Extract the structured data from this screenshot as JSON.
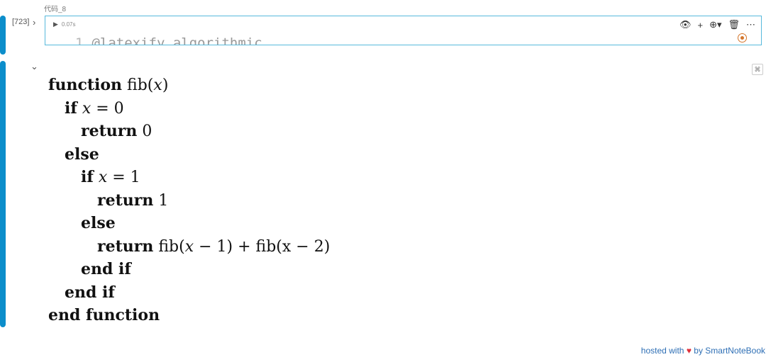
{
  "cell": {
    "name": "代码_8",
    "execution_count": "[723]",
    "collapse_glyph": "›",
    "run_time": "0.07s",
    "line_number": "1",
    "code": "@latexify.algorithmic"
  },
  "toolbar": {
    "eye": "👁",
    "add": "+",
    "puzzle": "⊕▾",
    "delete": "🗑",
    "more": "⋯"
  },
  "output": {
    "collapse_glyph": "⌄",
    "toggle_glyph": "⌘",
    "algorithm": [
      {
        "kw": "function",
        "rest": " fib(",
        "var": "x",
        "tail": ")"
      },
      {
        "kw": "if",
        "rest": " ",
        "var": "x",
        "tail": " = 0"
      },
      {
        "kw": "return",
        "rest": " 0",
        "var": "",
        "tail": ""
      },
      {
        "kw": "else",
        "rest": "",
        "var": "",
        "tail": ""
      },
      {
        "kw": "if",
        "rest": " ",
        "var": "x",
        "tail": " = 1"
      },
      {
        "kw": "return",
        "rest": " 1",
        "var": "",
        "tail": ""
      },
      {
        "kw": "else",
        "rest": "",
        "var": "",
        "tail": ""
      },
      {
        "kw": "return",
        "rest": " fib(",
        "var": "x",
        "tail": " − 1) + fib(x − 2)"
      },
      {
        "kw": "end if",
        "rest": "",
        "var": "",
        "tail": ""
      },
      {
        "kw": "end if",
        "rest": "",
        "var": "",
        "tail": ""
      },
      {
        "kw": "end function",
        "rest": "",
        "var": "",
        "tail": ""
      }
    ]
  },
  "footer": {
    "hosted": "hosted with",
    "heart": "♥",
    "by": "by SmartNoteBook"
  }
}
